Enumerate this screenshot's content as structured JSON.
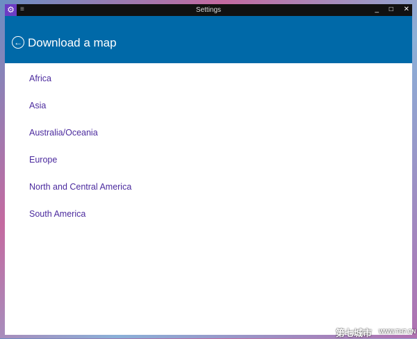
{
  "window": {
    "title": "Settings",
    "controls": {
      "minimize": "_",
      "maximize": "□",
      "close": "✕"
    },
    "menu_icon": "≡",
    "app_icon": "gear-icon"
  },
  "header": {
    "title": "Download a map",
    "back_icon": "back-arrow-circle-icon"
  },
  "regions": [
    "Africa",
    "Asia",
    "Australia/Oceania",
    "Europe",
    "North and Central America",
    "South America"
  ],
  "watermark": {
    "cn": "第七城市",
    "url": "WWW.TH7.CN"
  },
  "colors": {
    "header": "#0069a8",
    "link": "#4b2a9e",
    "titlebar": "#111111"
  }
}
